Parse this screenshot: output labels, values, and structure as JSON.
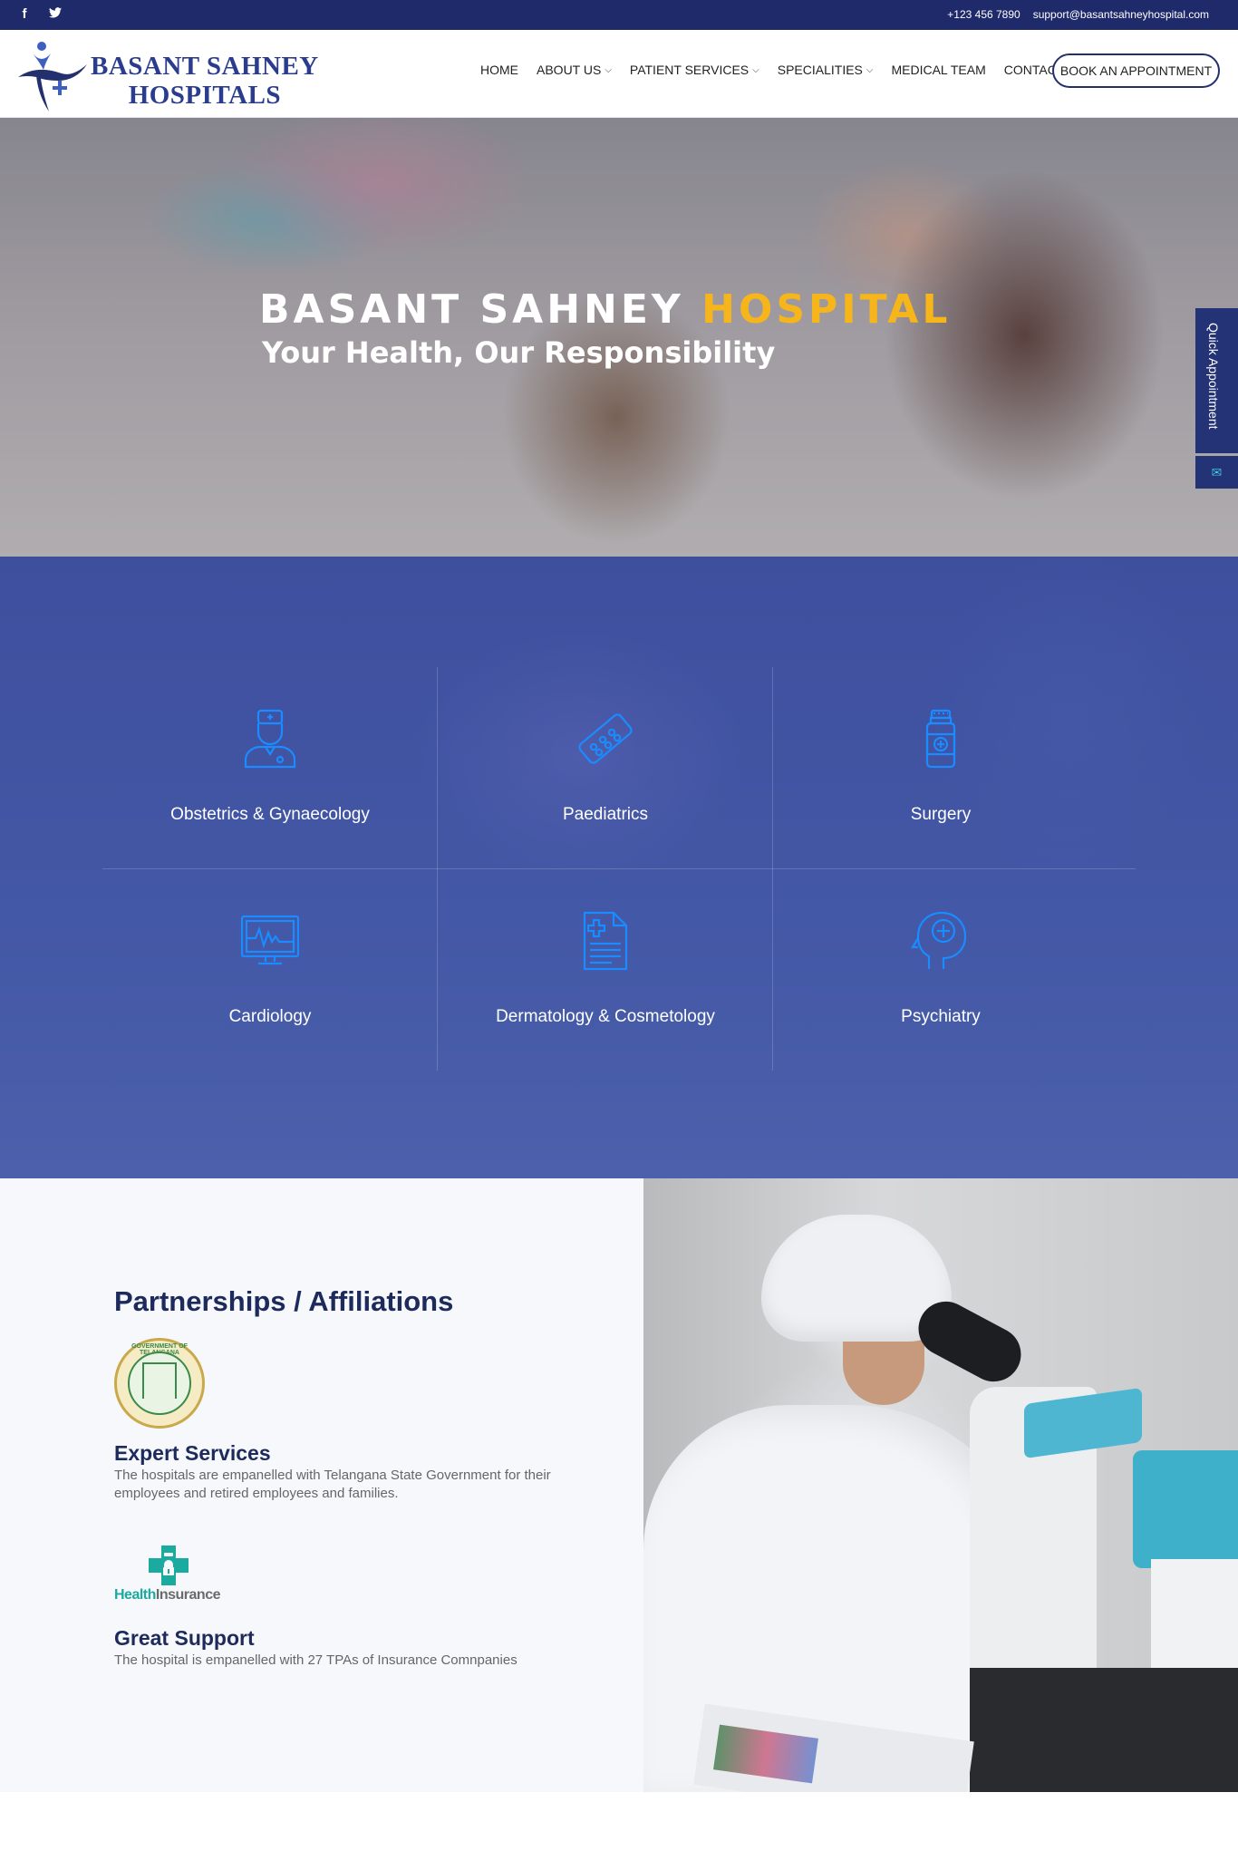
{
  "topbar": {
    "social": [
      {
        "name": "facebook",
        "glyph": "f"
      },
      {
        "name": "twitter",
        "glyph": "🐦"
      }
    ],
    "phone": "+123 456 7890",
    "email": "support@basantsahneyhospital.com"
  },
  "header": {
    "logo_line1": "BASANT SAHNEY",
    "logo_line2": "HOSPITALS",
    "nav": [
      {
        "label": "HOME",
        "dropdown": false
      },
      {
        "label": "ABOUT US",
        "dropdown": true
      },
      {
        "label": "PATIENT SERVICES",
        "dropdown": true
      },
      {
        "label": "SPECIALITIES",
        "dropdown": true
      },
      {
        "label": "MEDICAL TEAM",
        "dropdown": false
      },
      {
        "label": "CONTACT",
        "dropdown": false
      }
    ],
    "book_button": "BOOK AN APPOINTMENT"
  },
  "hero": {
    "title_main": "BASANT SAHNEY ",
    "title_accent": "HOSPITAL",
    "subtitle": "Your Health, Our Responsibility",
    "quick_appointment": "Quick Appointment"
  },
  "specialities": {
    "items": [
      {
        "name": "Obstetrics & Gynaecology",
        "icon": "doctor-icon"
      },
      {
        "name": "Paediatrics",
        "icon": "pill-strip-icon"
      },
      {
        "name": "Surgery",
        "icon": "medicine-bottle-icon"
      },
      {
        "name": "Cardiology",
        "icon": "heart-monitor-icon"
      },
      {
        "name": "Dermatology & Cosmetology",
        "icon": "medical-report-icon"
      },
      {
        "name": "Psychiatry",
        "icon": "head-cross-icon"
      }
    ],
    "icon_color": "#1a8cff"
  },
  "partners": {
    "heading": "Partnerships / Affiliations",
    "features": [
      {
        "title": "Expert Services",
        "desc": "The hospitals are empanelled with Telangana State Government for their employees and retired employees and families.",
        "logo": "telangana-government-seal"
      },
      {
        "title": "Great Support",
        "desc": "The hospital is empanelled with 27 TPAs of Insurance Comnpanies",
        "logo": "health-insurance-logo"
      }
    ],
    "seal_text": "GOVERNMENT OF TELANGANA",
    "health_insurance": {
      "part1": "Health",
      "part2": "Insurance"
    }
  },
  "colors": {
    "navy": "#1f2a6b",
    "accent": "#f6b51b",
    "teal": "#1aaaa0",
    "spec_bg": "#4358a6"
  }
}
